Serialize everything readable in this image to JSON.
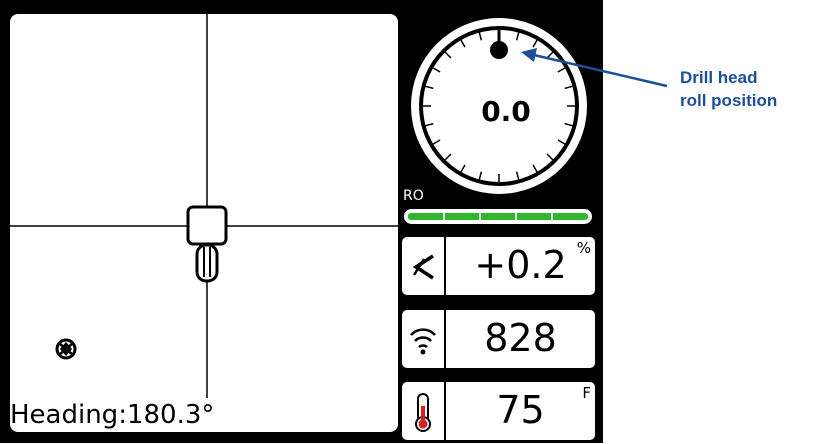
{
  "locate": {
    "heading_label": "Heading:",
    "heading_value": "180.3°",
    "target_icon": "locate-target-icon",
    "drill_head_icon": "drill-head-icon"
  },
  "roll": {
    "value": "0.0",
    "ticks": 24
  },
  "rate_of_update": {
    "label": "RO",
    "level": 1.0,
    "segments": 5,
    "color": "#2fb82f"
  },
  "readouts": {
    "pitch": {
      "icon": "pitch-icon",
      "value": "+0.2",
      "unit": "%"
    },
    "signal": {
      "icon": "signal-icon",
      "value": "828",
      "unit": ""
    },
    "temperature": {
      "icon": "thermometer-icon",
      "value": "75",
      "unit": "F"
    }
  },
  "annotation": {
    "line1": "Drill head",
    "line2": "roll position",
    "color": "#1b4f9c"
  }
}
